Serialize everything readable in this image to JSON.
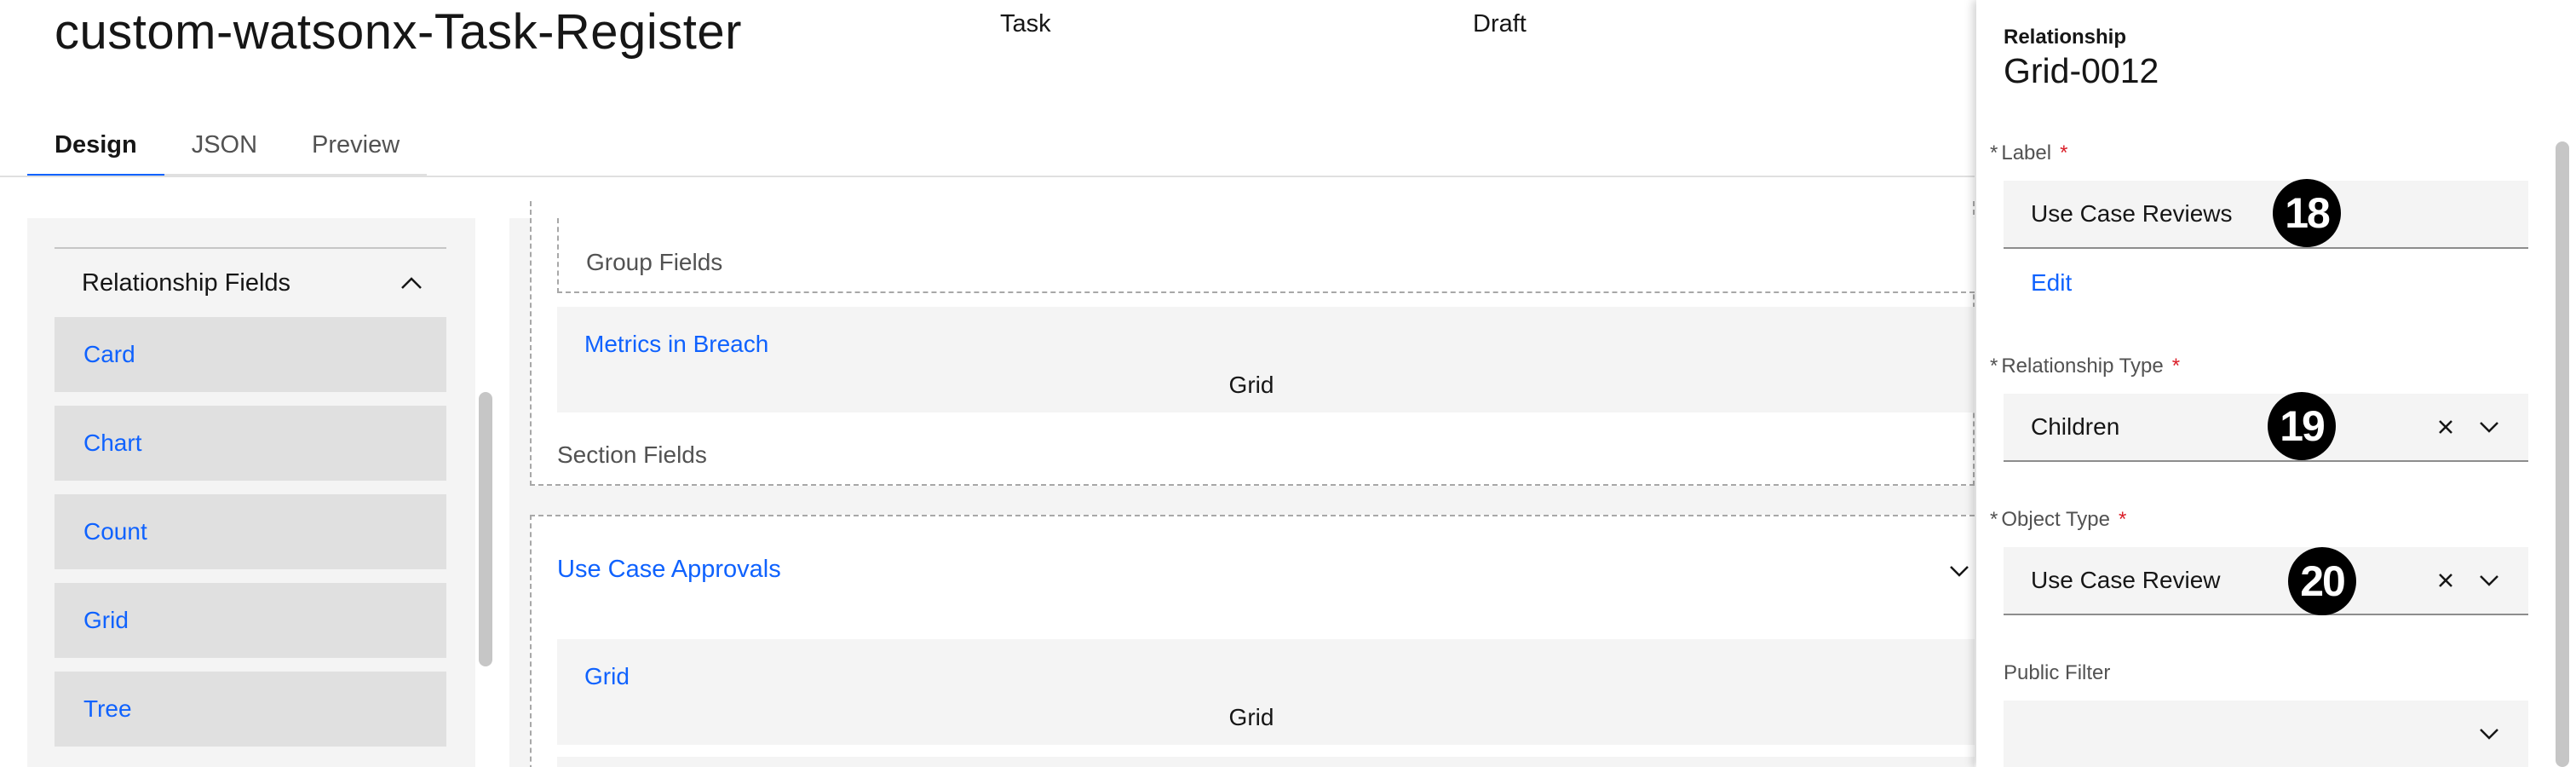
{
  "header": {
    "title": "custom-watsonx-Task-Register",
    "type": "Task",
    "status": "Draft",
    "tabs": [
      {
        "label": "Design",
        "active": true
      },
      {
        "label": "JSON",
        "active": false
      },
      {
        "label": "Preview",
        "active": false
      }
    ]
  },
  "palette": {
    "heading": "Relationship Fields",
    "items": [
      "Card",
      "Chart",
      "Count",
      "Grid",
      "Tree"
    ]
  },
  "canvas": {
    "group_label": "Group Fields",
    "card1": {
      "title": "Metrics in Breach",
      "subtitle": "Grid"
    },
    "section_label": "Section Fields",
    "section_title": "Use Case Approvals",
    "card2": {
      "title": "Grid",
      "subtitle": "Grid"
    }
  },
  "panel": {
    "kicker": "Relationship",
    "title": "Grid-0012",
    "label_field": {
      "label": "Label",
      "value": "Use Case Reviews"
    },
    "edit_link": "Edit",
    "relationship_type": {
      "label": "Relationship Type",
      "value": "Children"
    },
    "object_type": {
      "label": "Object Type",
      "value": "Use Case Review"
    },
    "public_filter": {
      "label": "Public Filter",
      "value": ""
    },
    "required_marker": "*"
  },
  "badges": [
    "18",
    "19",
    "20"
  ],
  "colors": {
    "accent": "#0f62fe",
    "required": "#da1e28",
    "field_bg": "#f4f4f4"
  }
}
